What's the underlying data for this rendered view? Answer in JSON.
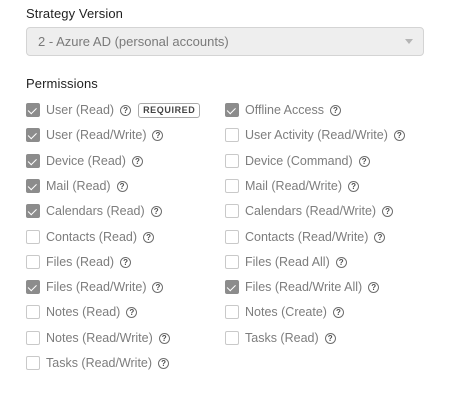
{
  "strategy": {
    "heading": "Strategy Version",
    "selected": "2 - Azure AD (personal accounts)"
  },
  "permissions": {
    "heading": "Permissions",
    "required_badge": "REQUIRED",
    "left": [
      {
        "label": "User (Read)",
        "checked": true,
        "required": true
      },
      {
        "label": "User (Read/Write)",
        "checked": true
      },
      {
        "label": "Device (Read)",
        "checked": true
      },
      {
        "label": "Mail (Read)",
        "checked": true
      },
      {
        "label": "Calendars (Read)",
        "checked": true
      },
      {
        "label": "Contacts (Read)",
        "checked": false
      },
      {
        "label": "Files (Read)",
        "checked": false
      },
      {
        "label": "Files (Read/Write)",
        "checked": true
      },
      {
        "label": "Notes (Read)",
        "checked": false
      },
      {
        "label": "Notes (Read/Write)",
        "checked": false
      },
      {
        "label": "Tasks (Read/Write)",
        "checked": false
      }
    ],
    "right": [
      {
        "label": "Offline Access",
        "checked": true
      },
      {
        "label": "User Activity (Read/Write)",
        "checked": false
      },
      {
        "label": "Device (Command)",
        "checked": false
      },
      {
        "label": "Mail (Read/Write)",
        "checked": false
      },
      {
        "label": "Calendars (Read/Write)",
        "checked": false
      },
      {
        "label": "Contacts (Read/Write)",
        "checked": false
      },
      {
        "label": "Files (Read All)",
        "checked": false
      },
      {
        "label": "Files (Read/Write All)",
        "checked": true
      },
      {
        "label": "Notes (Create)",
        "checked": false
      },
      {
        "label": "Tasks (Read)",
        "checked": false
      }
    ]
  },
  "icons": {
    "help": "question-circle-icon",
    "check": "checkmark-icon",
    "dropdown": "caret-down-icon"
  },
  "colors": {
    "checked_box": "#8c8c8c",
    "select_bg": "#eeeeee",
    "label_text": "#7d7d7d"
  }
}
